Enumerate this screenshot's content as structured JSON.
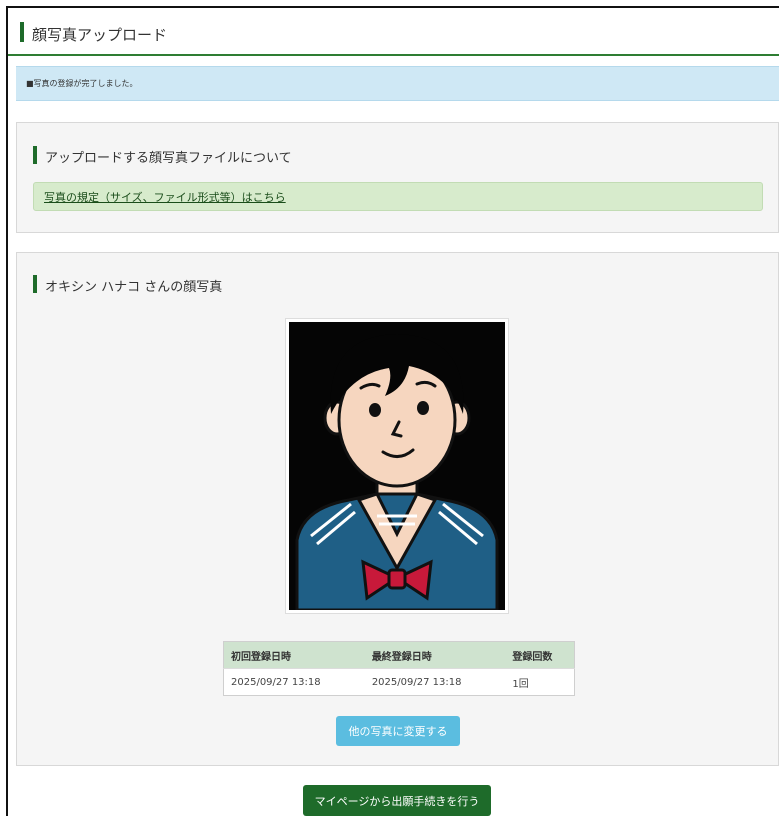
{
  "header": {
    "title": "顔写真アップロード"
  },
  "notice": {
    "text": "■写真の登録が完了しました。"
  },
  "file_section": {
    "heading": "アップロードする顔写真ファイルについて",
    "link_text": "写真の規定（サイズ、ファイル形式等）はこちら"
  },
  "photo_section": {
    "heading": "オキシン ハナコ さんの顔写真",
    "photo_icon": "student-portrait-illustration",
    "table": {
      "headers": [
        "初回登録日時",
        "最終登録日時",
        "登録回数"
      ],
      "rows": [
        [
          "2025/09/27 13:18",
          "2025/09/27 13:18",
          "1回"
        ]
      ]
    },
    "change_button": "他の写真に変更する"
  },
  "footer": {
    "proceed_button": "マイページから出願手続きを行う"
  },
  "colors": {
    "accent_green": "#1e6b2a",
    "notice_blue": "#cfe8f5",
    "link_box_green": "#d7ebcc",
    "change_button_blue": "#5bbde0"
  }
}
